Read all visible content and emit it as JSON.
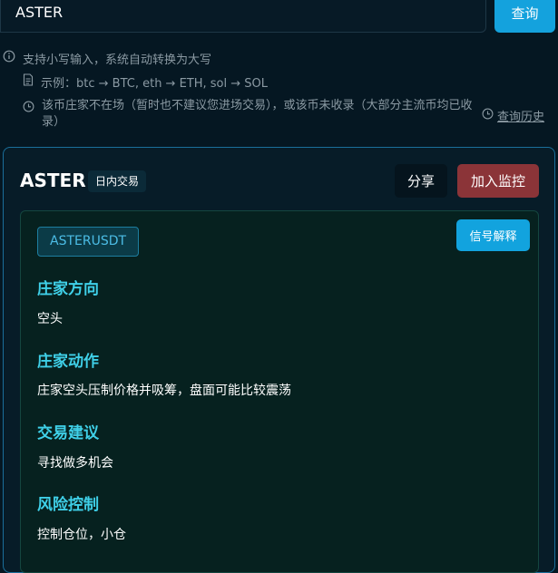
{
  "search": {
    "value": "ASTER",
    "button_label": "查询"
  },
  "hints": {
    "input_tip": "支持小写输入，系统自动转换为大写",
    "example": "示例：btc → BTC, eth → ETH, sol → SOL",
    "not_present": "该币庄家不在场（暂时也不建议您进场交易），或该币未收录（大部分主流币均已收录）",
    "history_link": "查询历史"
  },
  "card": {
    "title": "ASTER",
    "tag": "日内交易",
    "share_label": "分享",
    "monitor_label": "加入监控",
    "symbol": "ASTERUSDT",
    "explain_label": "信号解释",
    "sections": [
      {
        "heading": "庄家方向",
        "value": "空头"
      },
      {
        "heading": "庄家动作",
        "value": "庄家空头压制价格并吸筹，盘面可能比较震荡"
      },
      {
        "heading": "交易建议",
        "value": "寻找做多机会"
      },
      {
        "heading": "风险控制",
        "value": "控制仓位，小仓"
      }
    ]
  },
  "icons": {
    "info": "info-icon",
    "document": "document-icon",
    "clock": "clock-icon",
    "history": "history-clock-icon"
  },
  "colors": {
    "accent": "#14a2dd",
    "danger": "#8b3438",
    "heading": "#3fd0e8"
  }
}
